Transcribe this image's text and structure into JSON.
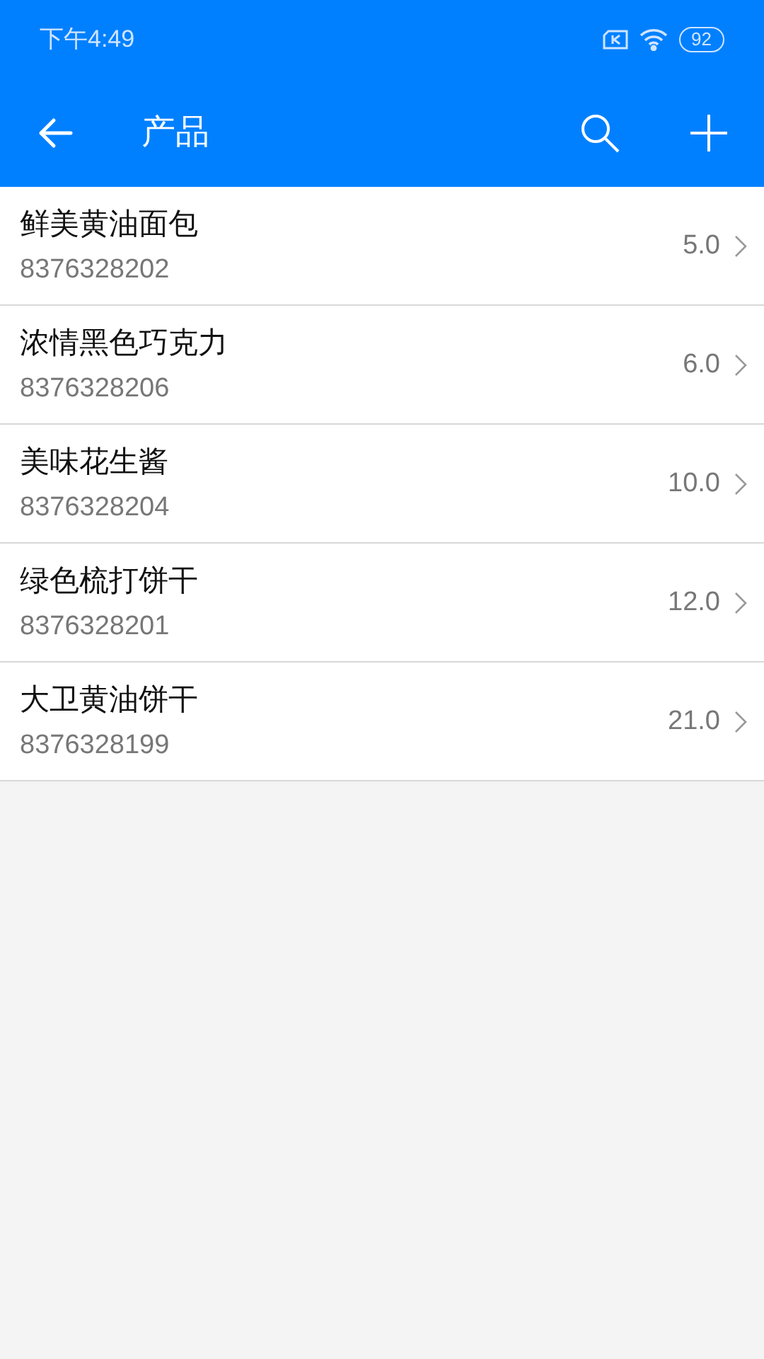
{
  "status_bar": {
    "time": "下午4:49",
    "battery": "92"
  },
  "header": {
    "title": "产品"
  },
  "products": [
    {
      "name": "鲜美黄油面包",
      "code": "8376328202",
      "price": "5.0"
    },
    {
      "name": "浓情黑色巧克力",
      "code": "8376328206",
      "price": "6.0"
    },
    {
      "name": "美味花生酱",
      "code": "8376328204",
      "price": "10.0"
    },
    {
      "name": "绿色梳打饼干",
      "code": "8376328201",
      "price": "12.0"
    },
    {
      "name": "大卫黄油饼干",
      "code": "8376328199",
      "price": "21.0"
    }
  ]
}
